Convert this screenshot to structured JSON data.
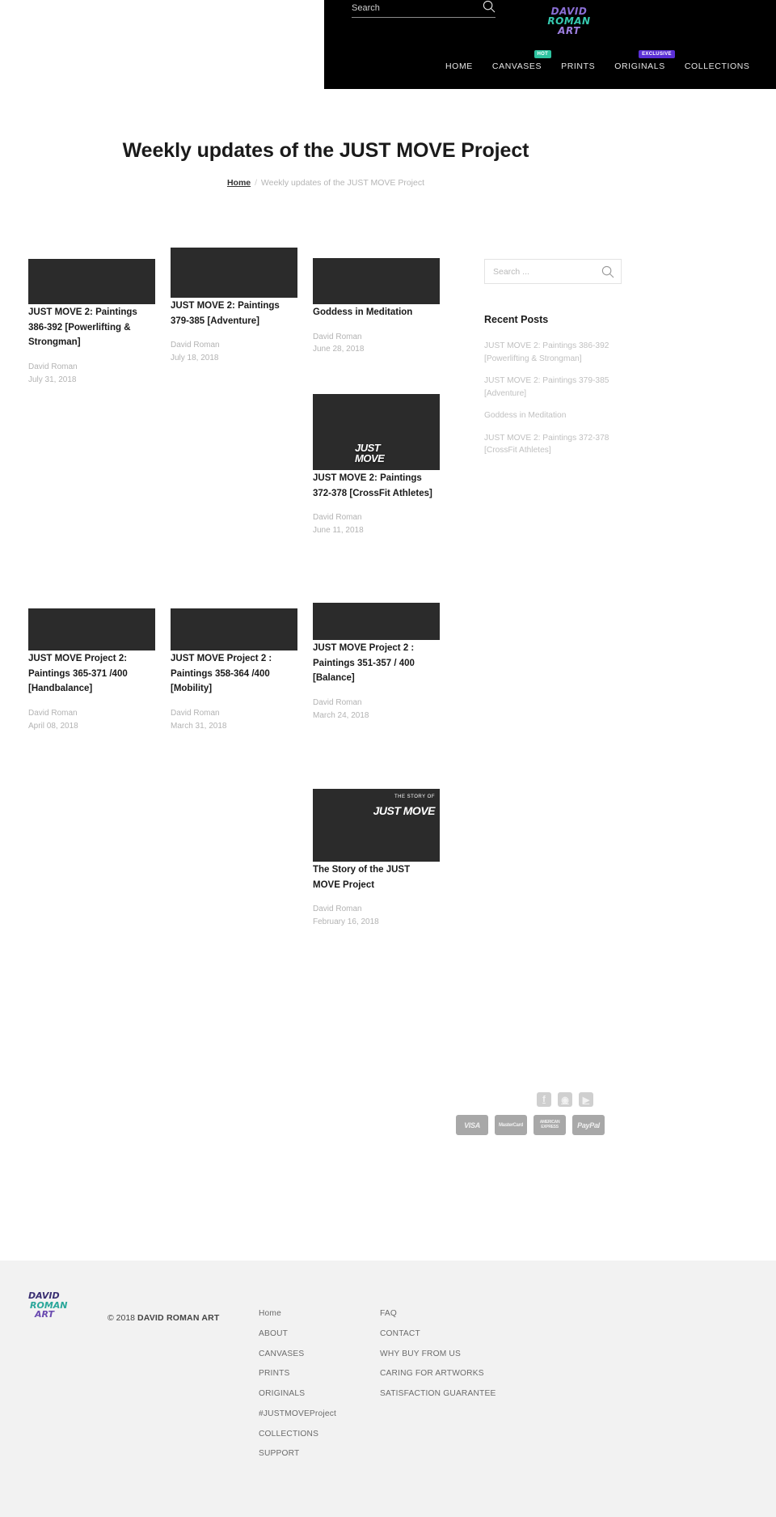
{
  "header": {
    "search_placeholder": "Search",
    "search_value": "",
    "search_icon": "search-icon",
    "logo": {
      "line1": "DAVID",
      "line2": "ROMAN",
      "line3": "ART"
    },
    "nav": [
      {
        "label": "HOME",
        "badge": null
      },
      {
        "label": "CANVASES",
        "badge": "HOT",
        "badge_color": "#2ec4a0"
      },
      {
        "label": "PRINTS",
        "badge": null
      },
      {
        "label": "ORIGINALS",
        "badge": "EXCLUSIVE",
        "badge_color": "#5b2fd6"
      },
      {
        "label": "COLLECTIONS",
        "badge": null
      }
    ]
  },
  "page": {
    "title": "Weekly updates of the JUST MOVE Project",
    "breadcrumb_home": "Home",
    "breadcrumb_sep": "/",
    "breadcrumb_current": "Weekly updates of the JUST MOVE Project"
  },
  "posts": [
    {
      "title": "JUST MOVE 2: Paintings 386-392 [Powerlifting & Strongman]",
      "author": "David Roman",
      "date": "July 31, 2018"
    },
    {
      "title": "JUST MOVE 2: Paintings 379-385 [Adventure]",
      "author": "David Roman",
      "date": "July 18, 2018"
    },
    {
      "title": "Goddess in Meditation",
      "author": "David Roman",
      "date": "June 28, 2018"
    },
    {
      "title": "JUST MOVE 2: Paintings 372-378 [CrossFit Athletes]",
      "author": "David Roman",
      "date": "June 11, 2018"
    },
    {
      "title": "JUST MOVE Project 2: Paintings 365-371 /400 [Handbalance]",
      "author": "David Roman",
      "date": "April 08, 2018"
    },
    {
      "title": "JUST MOVE Project 2 : Paintings 358-364 /400 [Mobility]",
      "author": "David Roman",
      "date": "March 31, 2018"
    },
    {
      "title": "JUST MOVE Project 2 : Paintings 351-357 / 400 [Balance]",
      "author": "David Roman",
      "date": "March 24, 2018"
    },
    {
      "title": "The Story of the JUST MOVE Project",
      "author": "David Roman",
      "date": "February 16, 2018"
    }
  ],
  "thumb_overlays": {
    "crossfit_mark": "JUST\nMOVE",
    "story_small": "THE STORY OF",
    "story_big": "JUST MOVE"
  },
  "sidebar": {
    "search_placeholder": "Search ...",
    "search_value": "",
    "search_icon": "search-icon",
    "recent_title": "Recent Posts",
    "recent_posts": [
      "JUST MOVE 2: Paintings 386-392 [Powerlifting & Strongman]",
      "JUST MOVE 2: Paintings 379-385 [Adventure]",
      "Goddess in Meditation",
      "JUST MOVE 2: Paintings 372-378 [CrossFit Athletes]"
    ]
  },
  "footer": {
    "logo": {
      "line1": "DAVID",
      "line2": "ROMAN",
      "line3": "ART"
    },
    "copyright_prefix": "© 2018 ",
    "copyright_brand": "DAVID ROMAN ART",
    "col1": [
      "Home",
      "ABOUT",
      "CANVASES",
      "PRINTS",
      "ORIGINALS",
      "#JUSTMOVEProject",
      "COLLECTIONS",
      "SUPPORT"
    ],
    "col2": [
      "FAQ",
      "CONTACT",
      "WHY BUY FROM US",
      "CARING FOR ARTWORKS",
      "SATISFACTION GUARANTEE"
    ],
    "socials": [
      {
        "name": "facebook-icon",
        "glyph": "f"
      },
      {
        "name": "instagram-icon",
        "glyph": "◉"
      },
      {
        "name": "youtube-icon",
        "glyph": "▶"
      }
    ],
    "payments": [
      {
        "name": "visa-logo",
        "label": "VISA"
      },
      {
        "name": "mastercard-logo",
        "label": "MasterCard"
      },
      {
        "name": "amex-logo",
        "label": "AMERICAN EXPRESS"
      },
      {
        "name": "paypal-logo",
        "label": "PayPal"
      }
    ]
  },
  "colors": {
    "header_bg": "#000000",
    "footer_bg": "#f2f2f2",
    "accent_hot": "#2ec4a0",
    "accent_exclusive": "#5b2fd6",
    "muted_text": "#b3b3b3"
  }
}
